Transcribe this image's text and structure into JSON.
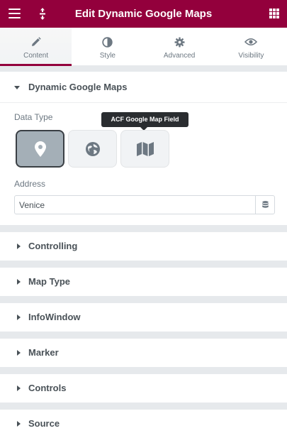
{
  "header": {
    "title": "Edit Dynamic Google Maps",
    "menu_icon": "hamburger-icon",
    "move_icon": "vertical-move-icon",
    "apps_icon": "grid-icon",
    "brand_color": "#93003c"
  },
  "tabs": [
    {
      "label": "Content",
      "icon": "pencil-icon",
      "active": true
    },
    {
      "label": "Style",
      "icon": "half-circle-icon",
      "active": false
    },
    {
      "label": "Advanced",
      "icon": "gear-icon",
      "active": false
    },
    {
      "label": "Visibility",
      "icon": "eye-icon",
      "active": false
    }
  ],
  "section_open": {
    "title": "Dynamic Google Maps",
    "data_type_label": "Data Type",
    "data_type_choices": [
      {
        "icon": "map-pin-icon",
        "selected": true
      },
      {
        "icon": "globe-icon",
        "selected": false
      },
      {
        "icon": "map-icon",
        "selected": false
      }
    ],
    "tooltip": "ACF Google Map Field",
    "address_label": "Address",
    "address_value": "Venice",
    "dynamic_icon": "database-icon"
  },
  "sections_closed": [
    {
      "title": "Controlling"
    },
    {
      "title": "Map Type"
    },
    {
      "title": "InfoWindow"
    },
    {
      "title": "Marker"
    },
    {
      "title": "Controls"
    },
    {
      "title": "Source"
    }
  ]
}
